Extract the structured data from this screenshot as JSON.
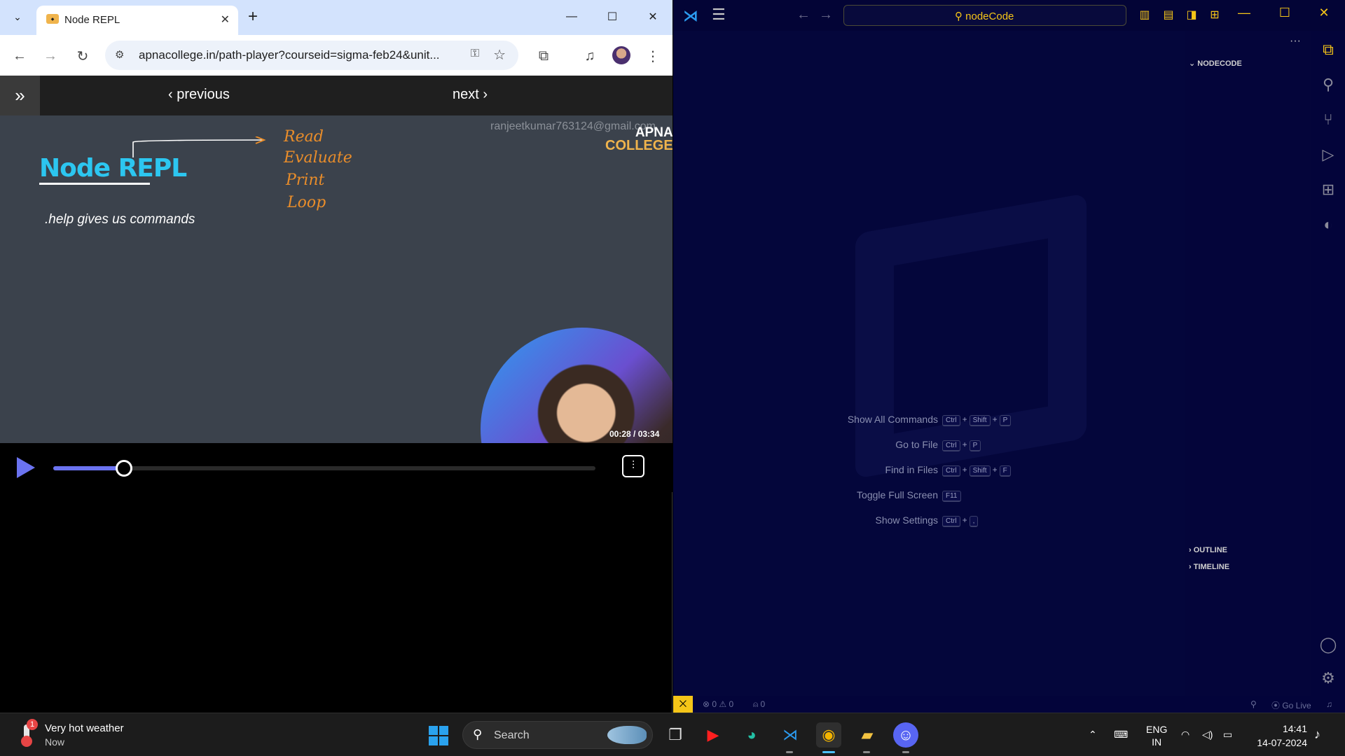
{
  "chrome": {
    "tab_title": "Node REPL",
    "url": "apnacollege.in/path-player?courseid=sigma-feb24&unit...",
    "icons": [
      "tab-list-icon",
      "close-icon",
      "plus-icon",
      "minimize-icon",
      "maximize-icon",
      "close-window-icon",
      "back-icon",
      "forward-icon",
      "reload-icon",
      "site-info-icon",
      "key-icon",
      "star-icon",
      "extensions-icon",
      "media-icon",
      "more-icon"
    ]
  },
  "page": {
    "prev_label": "‹ previous",
    "next_label": "next ›",
    "slide_title": "Node REPL",
    "slide_text": ".help gives us commands",
    "handwriting": [
      "Read",
      "Evaluate",
      "Print",
      "Loop"
    ],
    "watermark_email": "ranjeetkumar763124@gmail.com",
    "logo_line1": "APNA",
    "logo_line2": "COLLEGE",
    "timecode": "00:28 / 03:34",
    "progress_fraction": 0.131,
    "accent_color": "#6b73f0"
  },
  "vscode": {
    "command_center": "nodeCode",
    "explorer_folder": "NODECODE",
    "outline_label": "OUTLINE",
    "timeline_label": "TIMELINE",
    "shortcuts": [
      {
        "label": "Show All Commands",
        "keys": [
          "Ctrl",
          "Shift",
          "P"
        ]
      },
      {
        "label": "Go to File",
        "keys": [
          "Ctrl",
          "P"
        ]
      },
      {
        "label": "Find in Files",
        "keys": [
          "Ctrl",
          "Shift",
          "F"
        ]
      },
      {
        "label": "Toggle Full Screen",
        "keys": [
          "F11"
        ]
      },
      {
        "label": "Show Settings",
        "keys": [
          "Ctrl",
          ","
        ]
      }
    ],
    "status_errors": "0",
    "status_warnings": "0",
    "status_ports": "0",
    "status_golive": "Go Live",
    "accent_color": "#f5c518"
  },
  "taskbar": {
    "weather_title": "Very hot weather",
    "weather_sub": "Now",
    "weather_badge": "1",
    "search_label": "Search",
    "lang_line1": "ENG",
    "lang_line2": "IN",
    "time": "14:41",
    "date": "14-07-2024"
  }
}
